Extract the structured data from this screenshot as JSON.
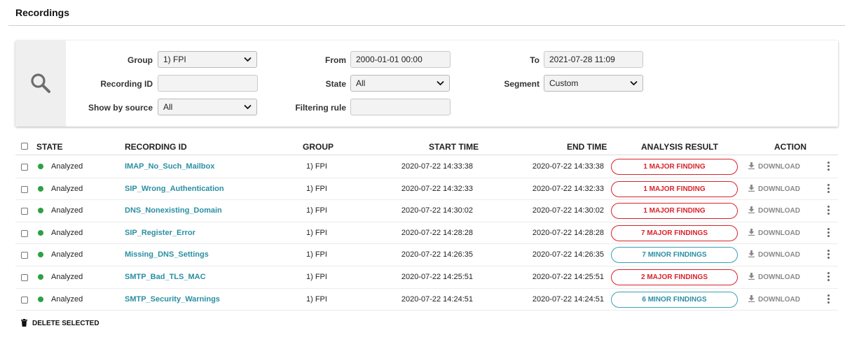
{
  "page": {
    "title": "Recordings"
  },
  "filters": {
    "group": {
      "label": "Group",
      "value": "1) FPI"
    },
    "recording_id": {
      "label": "Recording ID",
      "value": ""
    },
    "show_by_source": {
      "label": "Show by source",
      "value": "All"
    },
    "from": {
      "label": "From",
      "value": "2000-01-01 00:00"
    },
    "state": {
      "label": "State",
      "value": "All"
    },
    "filtering_rule": {
      "label": "Filtering rule",
      "value": ""
    },
    "to": {
      "label": "To",
      "value": "2021-07-28 11:09"
    },
    "segment": {
      "label": "Segment",
      "value": "Custom"
    }
  },
  "table": {
    "headers": {
      "state": "STATE",
      "recording_id": "RECORDING ID",
      "group": "GROUP",
      "start_time": "START TIME",
      "end_time": "END TIME",
      "analysis_result": "ANALYSIS RESULT",
      "action": "ACTION"
    },
    "download_label": "DOWNLOAD",
    "rows": [
      {
        "state": "Analyzed",
        "id": "IMAP_No_Such_Mailbox",
        "group": "1) FPI",
        "start": "2020-07-22 14:33:38",
        "end": "2020-07-22 14:33:38",
        "result": "1 MAJOR FINDING",
        "severity": "major"
      },
      {
        "state": "Analyzed",
        "id": "SIP_Wrong_Authentication",
        "group": "1) FPI",
        "start": "2020-07-22 14:32:33",
        "end": "2020-07-22 14:32:33",
        "result": "1 MAJOR FINDING",
        "severity": "major"
      },
      {
        "state": "Analyzed",
        "id": "DNS_Nonexisting_Domain",
        "group": "1) FPI",
        "start": "2020-07-22 14:30:02",
        "end": "2020-07-22 14:30:02",
        "result": "1 MAJOR FINDING",
        "severity": "major"
      },
      {
        "state": "Analyzed",
        "id": "SIP_Register_Error",
        "group": "1) FPI",
        "start": "2020-07-22 14:28:28",
        "end": "2020-07-22 14:28:28",
        "result": "7 MAJOR FINDINGS",
        "severity": "major"
      },
      {
        "state": "Analyzed",
        "id": "Missing_DNS_Settings",
        "group": "1) FPI",
        "start": "2020-07-22 14:26:35",
        "end": "2020-07-22 14:26:35",
        "result": "7 MINOR FINDINGS",
        "severity": "minor"
      },
      {
        "state": "Analyzed",
        "id": "SMTP_Bad_TLS_MAC",
        "group": "1) FPI",
        "start": "2020-07-22 14:25:51",
        "end": "2020-07-22 14:25:51",
        "result": "2 MAJOR FINDINGS",
        "severity": "major"
      },
      {
        "state": "Analyzed",
        "id": "SMTP_Security_Warnings",
        "group": "1) FPI",
        "start": "2020-07-22 14:24:51",
        "end": "2020-07-22 14:24:51",
        "result": "6 MINOR FINDINGS",
        "severity": "minor"
      }
    ]
  },
  "footer": {
    "delete_label": "DELETE SELECTED"
  },
  "colors": {
    "major": "#d9232a",
    "minor": "#2a8fa3",
    "link": "#2a8fa3",
    "state_ok": "#2ea043"
  },
  "icons": {
    "search": "search-icon",
    "chevron": "chevron-down-icon",
    "download": "download-icon",
    "more": "kebab-icon",
    "trash": "trash-icon"
  }
}
